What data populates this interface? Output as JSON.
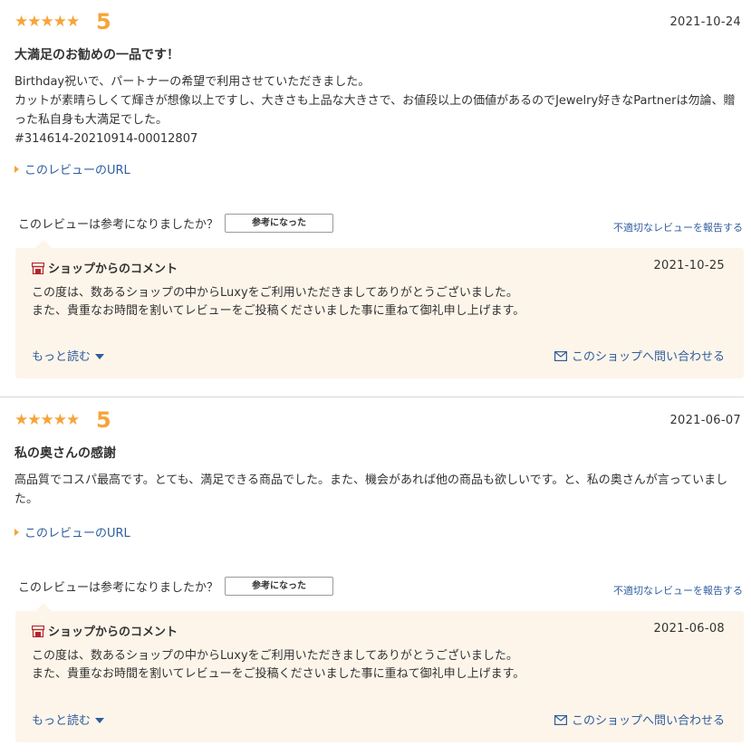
{
  "colors": {
    "star": "#f7a43a",
    "link": "#2f5d9e",
    "shop_bg": "#fdf5ea"
  },
  "reviews": [
    {
      "stars": "★★★★★",
      "score": "5",
      "date": "2021-10-24",
      "title": "大満足のお勧めの一品です！",
      "body": [
        "Birthday祝いで、パートナーの希望で利用させていただきました。",
        "カットが素晴らしくて輝きが想像以上ですし、大きさも上品な大きさで、お値段以上の価値があるのでJewelry好きなPartnerは勿論、贈った私自身も大満足でした。",
        "#314614-20210914-00012807"
      ],
      "url_label": "このレビューのURL",
      "helpful_question": "このレビューは参考になりましたか？",
      "helpful_button": "参考になった",
      "report_label": "不適切なレビューを報告する",
      "shop": {
        "heading": "ショップからのコメント",
        "date": "2021-10-25",
        "lines": [
          "この度は、数あるショップの中からLuxyをご利用いただきましてありがとうございました。",
          "また、貴重なお時間を割いてレビューをご投稿くださいました事に重ねて御礼申し上げます。"
        ],
        "more_label": "もっと読む",
        "contact_label": "このショップへ問い合わせる"
      }
    },
    {
      "stars": "★★★★★",
      "score": "5",
      "date": "2021-06-07",
      "title": "私の奥さんの感謝",
      "body": [
        "高品質でコスパ最高です。とても、満足できる商品でした。また、機会があれば他の商品も欲しいです。と、私の奥さんが言っていました。"
      ],
      "url_label": "このレビューのURL",
      "helpful_question": "このレビューは参考になりましたか？",
      "helpful_button": "参考になった",
      "report_label": "不適切なレビューを報告する",
      "shop": {
        "heading": "ショップからのコメント",
        "date": "2021-06-08",
        "lines": [
          "この度は、数あるショップの中からLuxyをご利用いただきましてありがとうございました。",
          "また、貴重なお時間を割いてレビューをご投稿くださいました事に重ねて御礼申し上げます。"
        ],
        "more_label": "もっと読む",
        "contact_label": "このショップへ問い合わせる"
      }
    }
  ]
}
